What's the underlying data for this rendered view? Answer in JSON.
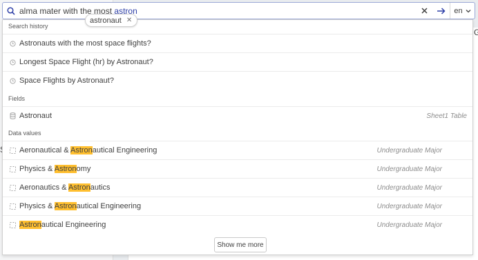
{
  "search": {
    "query_prefix": "alma mater with the most ",
    "query_highlight": "astron",
    "clear_icon": "close-icon",
    "submit_icon": "arrow-right-icon",
    "language": "en"
  },
  "suggestion_chip": {
    "label": "astronaut"
  },
  "background": {
    "right_glyph": "G",
    "left_glyph": "S"
  },
  "dropdown": {
    "search_history_label": "Search history",
    "history": [
      "Astronauts with the most space flights?",
      "Longest Space Flight (hr) by Astronaut?",
      "Space Flights by Astronaut?"
    ],
    "fields_label": "Fields",
    "fields": [
      {
        "name": "Astronaut",
        "meta": "Sheet1 Table"
      }
    ],
    "data_values_label": "Data values",
    "data_values": [
      {
        "before": "Aeronautical & ",
        "match": "Astron",
        "after": "autical Engineering",
        "meta": "Undergraduate Major"
      },
      {
        "before": "Physics & ",
        "match": "Astron",
        "after": "omy",
        "meta": "Undergraduate Major"
      },
      {
        "before": "Aeronautics & ",
        "match": "Astron",
        "after": "autics",
        "meta": "Undergraduate Major"
      },
      {
        "before": "Physics & ",
        "match": "Astron",
        "after": "autical Engineering",
        "meta": "Undergraduate Major"
      },
      {
        "before": "",
        "match": "Astron",
        "after": "autical Engineering",
        "meta": "Undergraduate Major"
      }
    ],
    "show_more_label": "Show me more"
  },
  "colors": {
    "accent": "#2d3fa7",
    "highlight": "#ffbf2f"
  }
}
